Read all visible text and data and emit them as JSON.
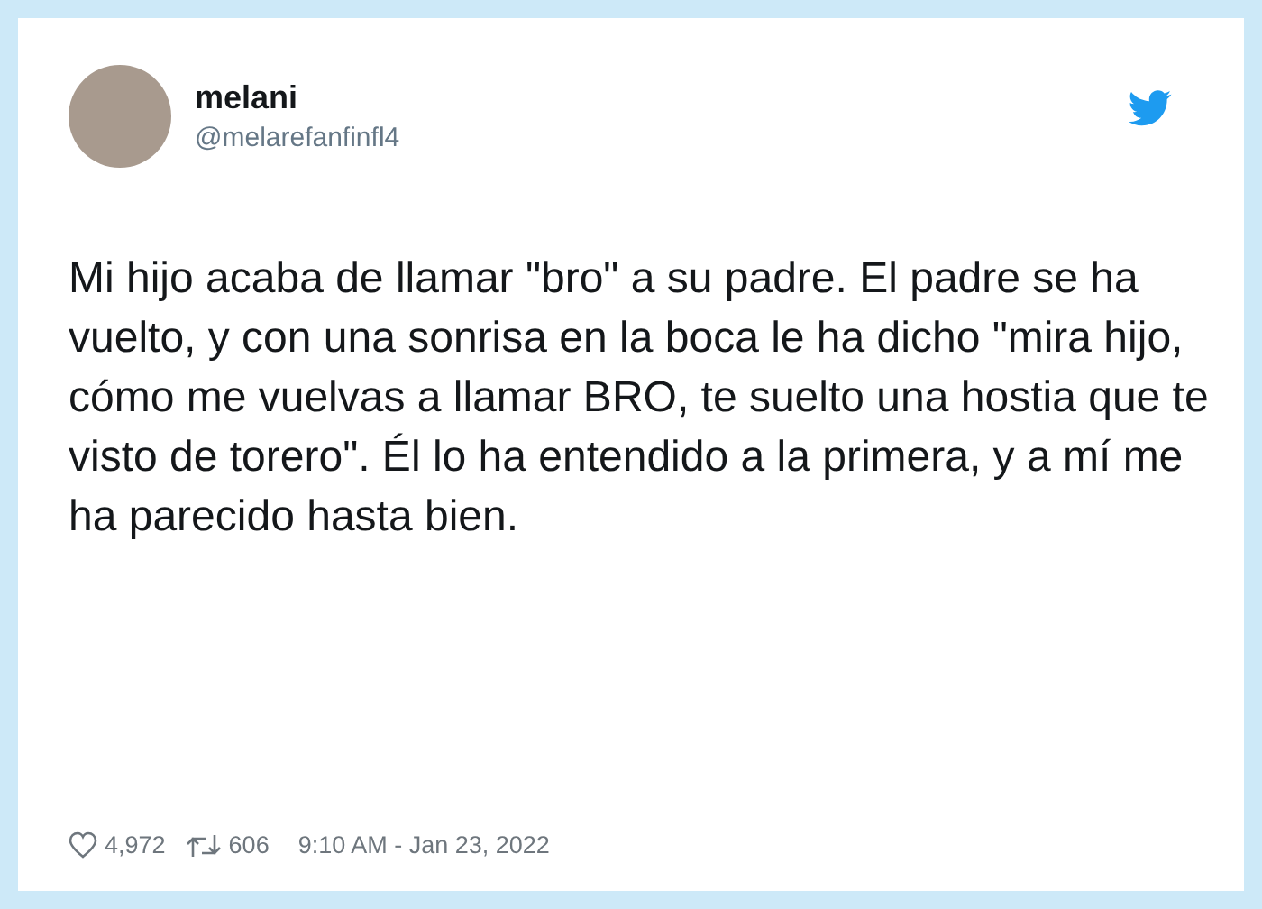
{
  "tweet": {
    "author": {
      "name": "melani",
      "handle": "@melarefanfinfl4"
    },
    "text": "Mi hijo acaba de llamar \"bro\" a su padre. El padre se ha vuelto, y con una sonrisa en la boca le ha dicho \"mira hijo, cómo me vuelvas a llamar BRO, te suelto una hostia que te visto de torero\". Él lo ha entendido a la primera, y a mí me ha parecido hasta bien.",
    "likes": "4,972",
    "retweets": "606",
    "timestamp": "9:10 AM - Jan 23, 2022"
  }
}
